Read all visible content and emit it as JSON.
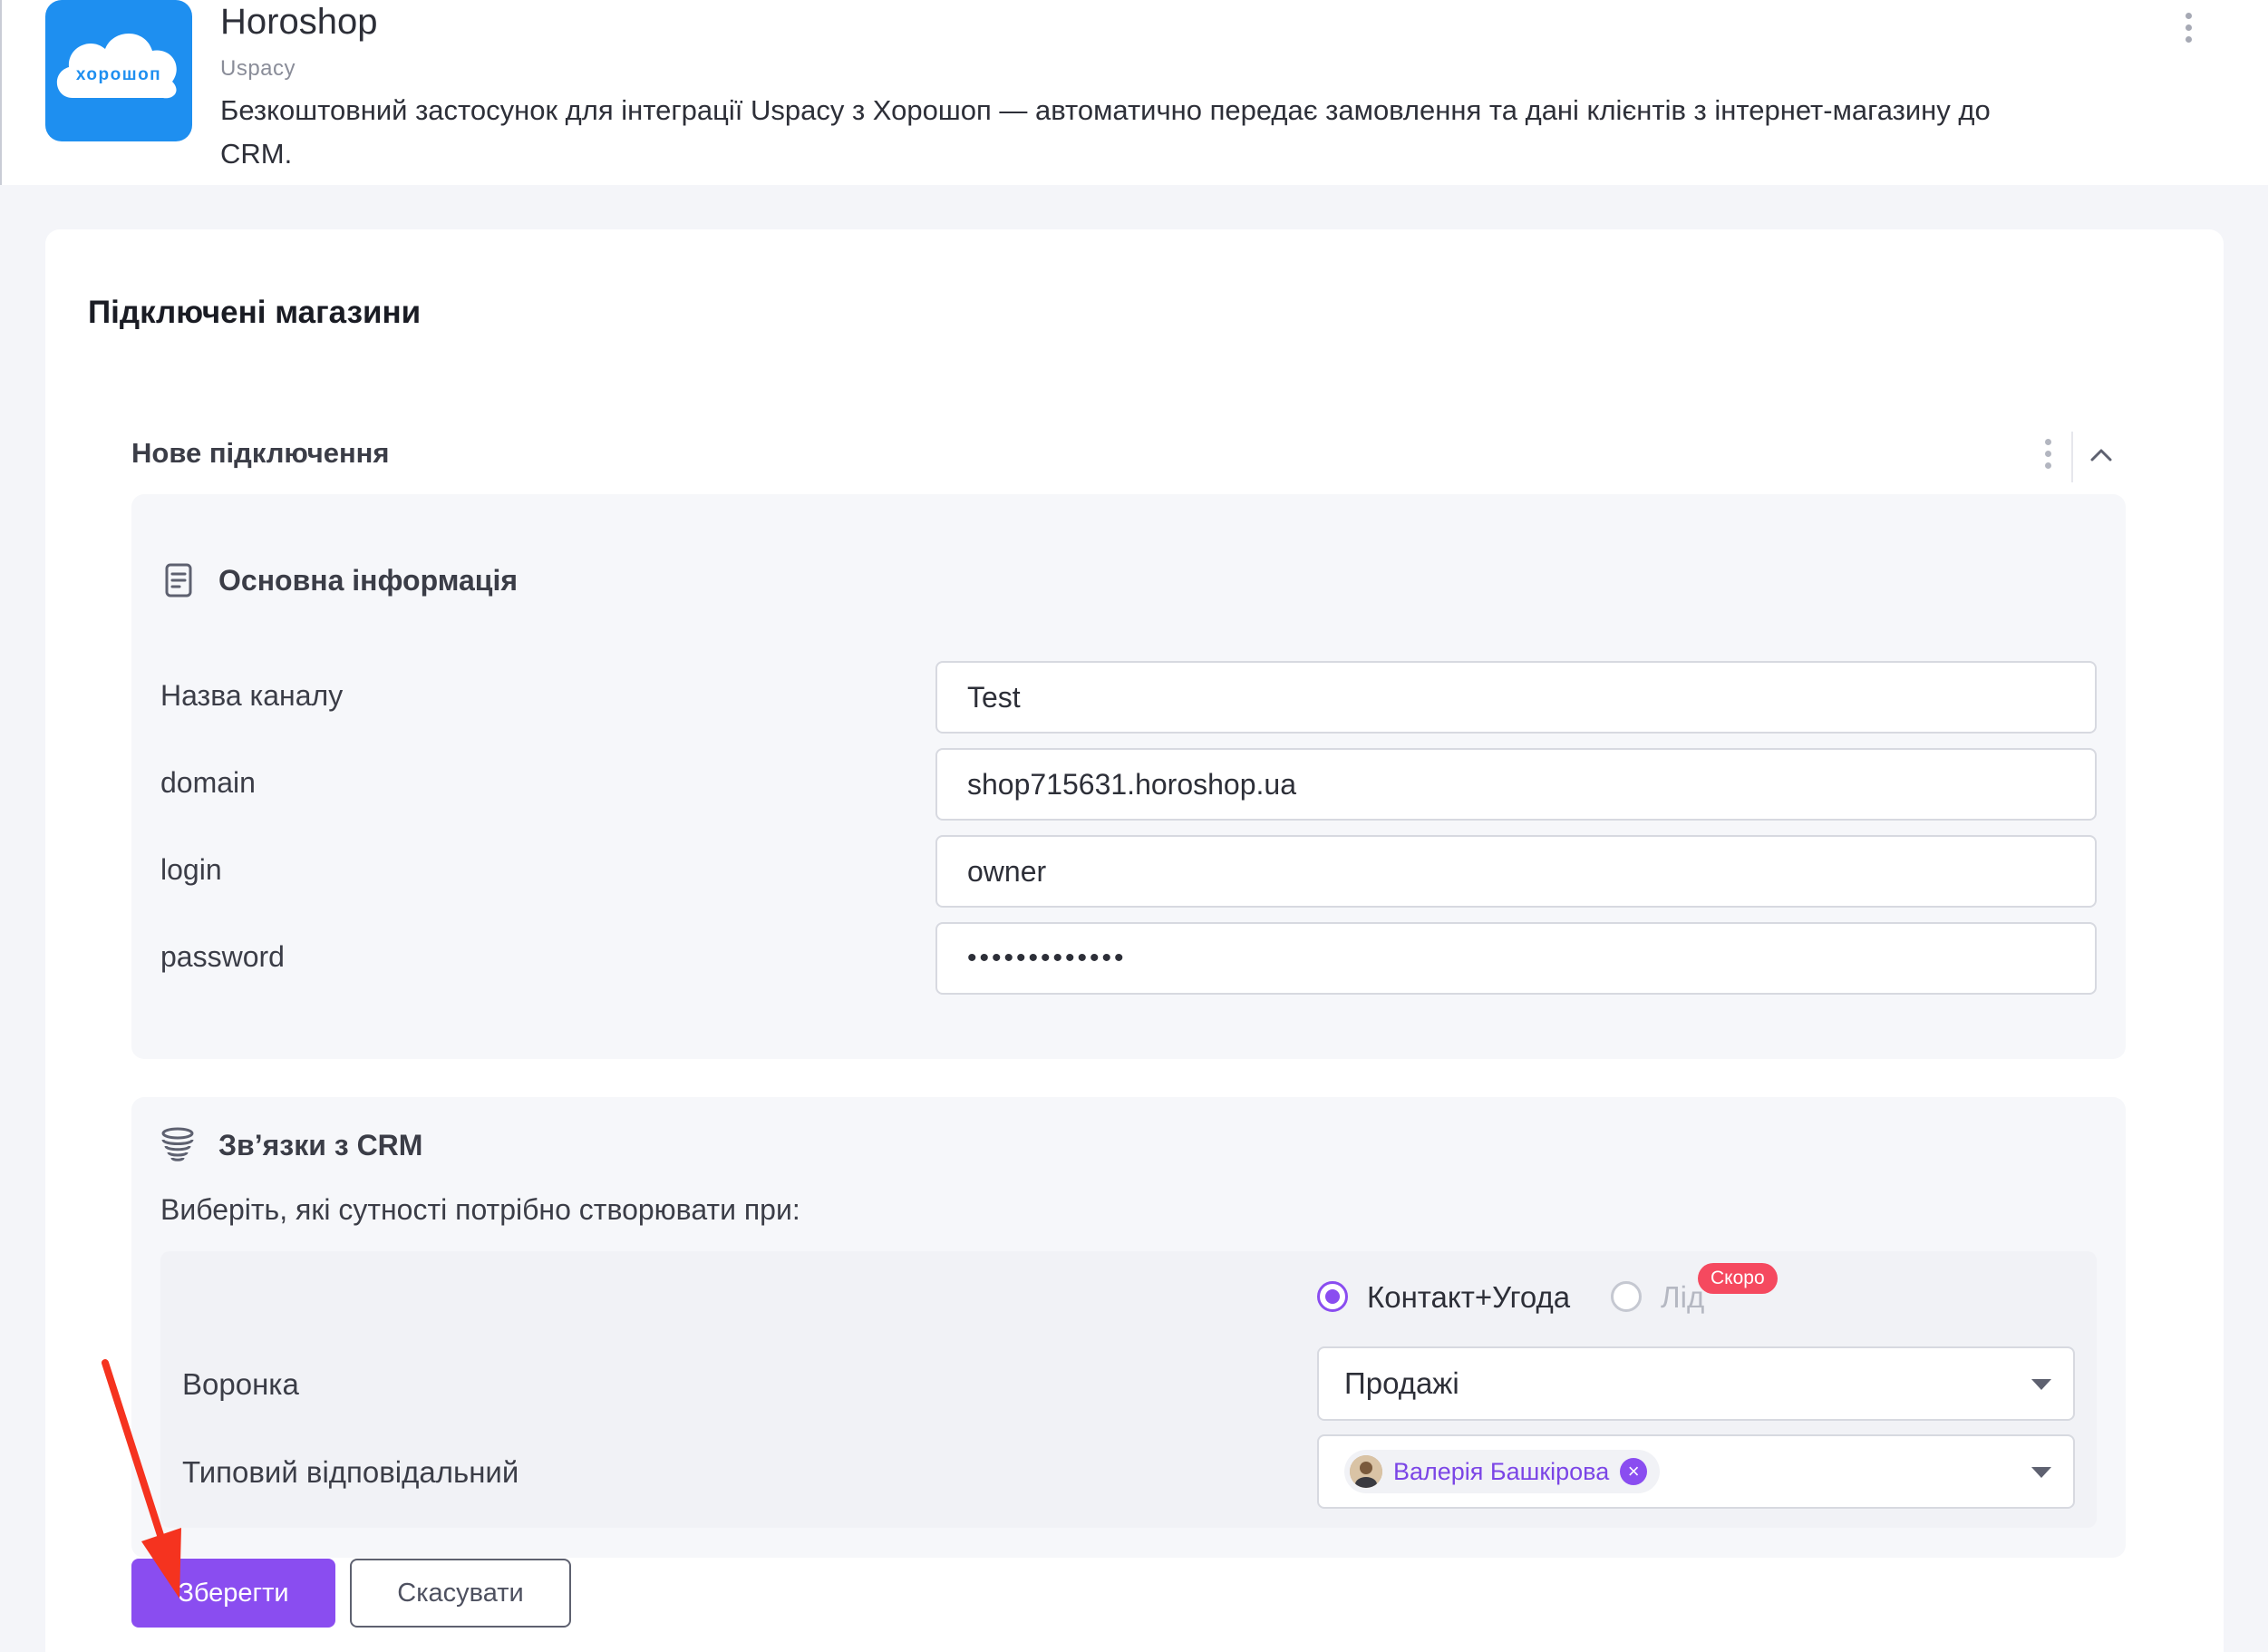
{
  "app": {
    "title": "Horoshop",
    "vendor": "Uspacy",
    "description": "Безкоштовний застосунок для інтеграції Uspacy з Хорошоп — автоматично передає замовлення та дані клієнтів з інтернет-магазину до CRM.",
    "logo_text": "хорошоп",
    "logo_color": "#1e8ff0"
  },
  "page": {
    "section_title": "Підключені магазини",
    "connection_title": "Нове підключення"
  },
  "info_panel": {
    "title": "Основна інформація",
    "icon": "document-icon",
    "fields": [
      {
        "label": "Назва каналу",
        "value": "Test"
      },
      {
        "label": "domain",
        "value": "shop715631.horoshop.ua"
      },
      {
        "label": "login",
        "value": "owner"
      },
      {
        "label": "password",
        "value": "•••••••••••••"
      }
    ]
  },
  "crm_panel": {
    "title": "Зв’язки з CRM",
    "icon": "database-icon",
    "hint": "Виберіть, які сутності потрібно створювати при:",
    "options": [
      {
        "label": "Контакт+Угода",
        "selected": true
      },
      {
        "label": "Лід",
        "selected": false,
        "badge": "Скоро"
      }
    ],
    "funnel": {
      "label": "Воронка",
      "value": "Продажі"
    },
    "responsible": {
      "label": "Типовий відповідальний",
      "value": "Валерія Башкірова"
    }
  },
  "actions": {
    "save_label": "Зберегти",
    "cancel_label": "Скасувати"
  },
  "colors": {
    "accent": "#8a4df0",
    "badge": "#f5495f",
    "annotation_arrow": "#f5331f"
  }
}
